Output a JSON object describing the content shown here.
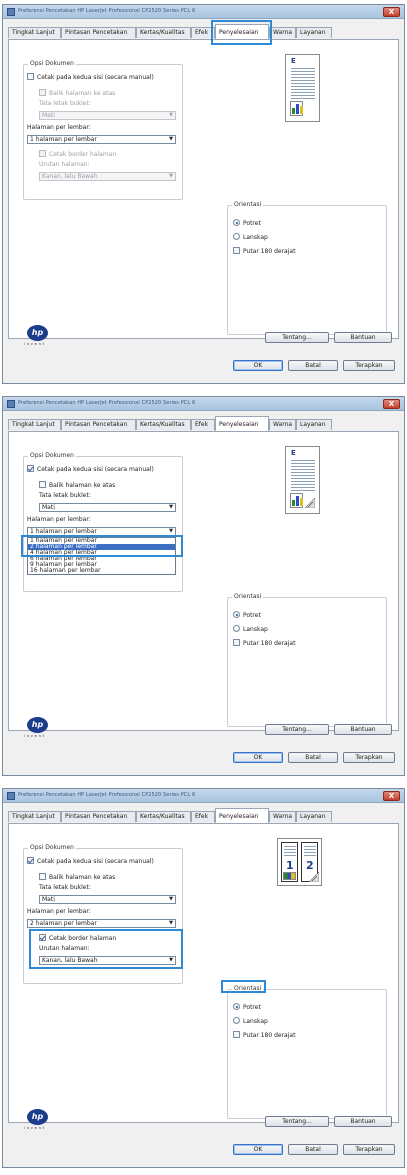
{
  "window": {
    "title": "Preferensi Pencetakan HP LaserJet Professional CP2520 Series PCL 6",
    "close_label": "X"
  },
  "tabs": [
    "Tingkat Lanjut",
    "Pintasan Pencetakan",
    "Kertas/Kualitas",
    "Efek",
    "Penyelesaian",
    "Warna",
    "Layanan"
  ],
  "active_tab": "Penyelesaian",
  "document_options": {
    "group_label": "Opsi Dokumen",
    "print_both_sides": "Cetak pada kedua sisi (secara manual)",
    "flip_pages_up": "Balik halaman ke atas",
    "booklet_layout_label": "Tata letak buklet:",
    "booklet_layout_value": "Mati",
    "pages_per_sheet_label": "Halaman per lembar:",
    "print_page_borders": "Cetak border halaman",
    "page_order_label": "Urutan halaman:",
    "page_order_value": "Kanan, lalu Bawah",
    "dropdown_options": [
      "1 halaman per lembar",
      "2 halaman per lembar",
      "4 halaman per lembar",
      "6 halaman per lembar",
      "9 halaman per lembar",
      "16 halaman per lembar"
    ]
  },
  "orientation": {
    "group_label": "Orientasi",
    "portrait": "Potret",
    "landscape": "Lanskap",
    "rotate_180": "Putar 180 derajat"
  },
  "logo": {
    "text": "hp",
    "tagline": "invent"
  },
  "buttons": {
    "about": "Tentang...",
    "help": "Bantuan",
    "ok": "OK",
    "cancel": "Batal",
    "apply": "Terapkan"
  },
  "preview_labels": {
    "page_letter": "E",
    "page1": "1",
    "page2": "2"
  },
  "screenshots": [
    {
      "step": 1,
      "pages_per_sheet": "1 halaman per lembar",
      "both_sides_checked": false,
      "dropdown_open": false,
      "borders_checked": false,
      "page_order_enabled": false,
      "preview": "single"
    },
    {
      "step": 2,
      "pages_per_sheet": "1 halaman per lembar",
      "both_sides_checked": true,
      "dropdown_open": true,
      "highlighted_option": "2 halaman per lembar",
      "borders_checked": false,
      "page_order_enabled": false,
      "preview": "duplex"
    },
    {
      "step": 3,
      "pages_per_sheet": "2 halaman per lembar",
      "both_sides_checked": true,
      "dropdown_open": false,
      "borders_checked": true,
      "page_order_enabled": true,
      "preview": "two-up"
    }
  ],
  "colors": {
    "highlight_box": "#2e8ad6",
    "selection": "#3b6fc4",
    "hp_blue": "#1c3c8c"
  }
}
